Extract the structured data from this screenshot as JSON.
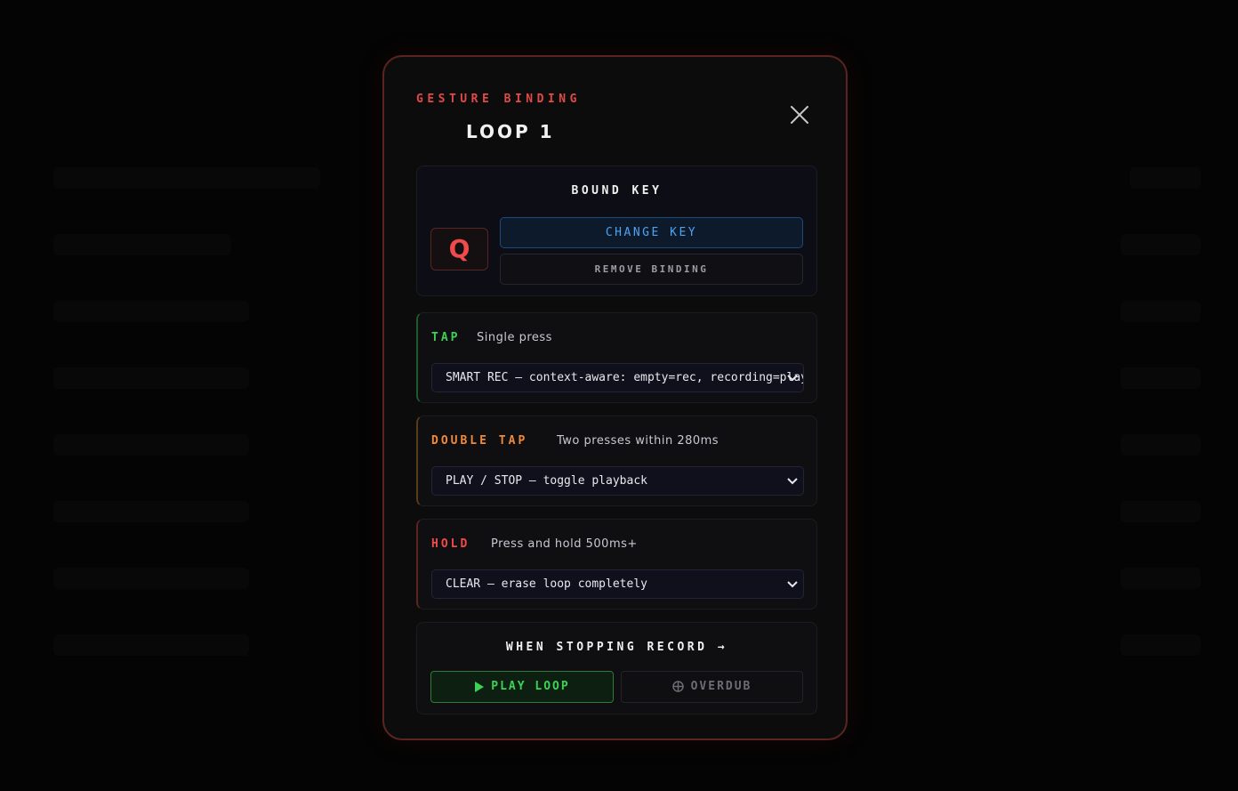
{
  "modal": {
    "eyebrow": "GESTURE BINDING",
    "title": "LOOP 1",
    "close_icon": "close-icon"
  },
  "bound_key": {
    "heading": "BOUND KEY",
    "key": "Q",
    "change_label": "CHANGE KEY",
    "remove_label": "REMOVE BINDING"
  },
  "gestures": {
    "tap": {
      "label": "TAP",
      "desc": "Single press",
      "selected": "SMART REC — context-aware: empty=rec, recording=play",
      "color": "#3ed158"
    },
    "double_tap": {
      "label": "DOUBLE TAP",
      "desc": "Two presses within 280ms",
      "selected": "PLAY / STOP — toggle playback",
      "color": "#f08a3a"
    },
    "hold": {
      "label": "HOLD",
      "desc": "Press and hold 500ms+",
      "selected": "CLEAR — erase loop completely",
      "color": "#f04a4a"
    }
  },
  "stop_record": {
    "heading": "WHEN STOPPING RECORD →",
    "play_label": "PLAY LOOP",
    "overdub_label": "OVERDUB",
    "active": "play"
  }
}
